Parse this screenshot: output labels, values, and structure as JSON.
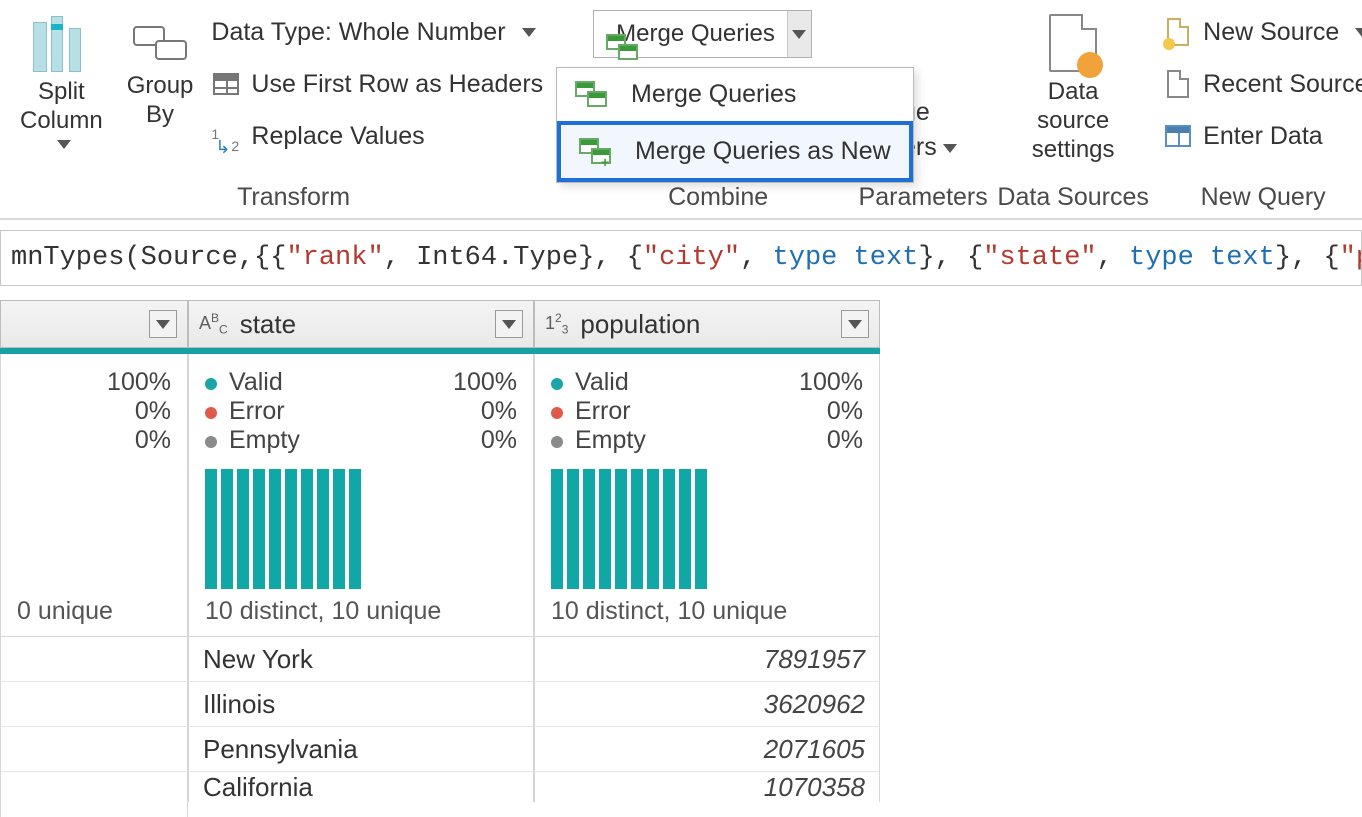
{
  "ribbon": {
    "transform": {
      "split_column": "Split\nColumn",
      "group_by": "Group\nBy",
      "data_type": "Data Type: Whole Number",
      "first_row": "Use First Row as Headers",
      "replace_values": "Replace Values",
      "label": "Transform"
    },
    "combine": {
      "merge_queries": "Merge Queries",
      "menu_merge": "Merge Queries",
      "menu_merge_new": "Merge Queries as New",
      "label": "Combine"
    },
    "parameters": {
      "big": "ge",
      "ers": "ers",
      "label": "Parameters"
    },
    "datasources": {
      "big": "Data source\nsettings",
      "label": "Data Sources"
    },
    "newquery": {
      "new_source": "New Source",
      "recent_sources": "Recent Sources",
      "enter_data": "Enter Data",
      "label": "New Query"
    }
  },
  "formula": {
    "p0": "mnTypes(Source,{{",
    "s1": "\"rank\"",
    "p1": ", Int64.Type}, {",
    "s2": "\"city\"",
    "p2": ", ",
    "kw1": "type text",
    "p3": "}, {",
    "s3": "\"state\"",
    "p4": ", ",
    "kw2": "type text",
    "p5": "}, {",
    "s4": "\"population\"",
    "p6": ","
  },
  "columns": {
    "partial": {
      "distinct": "0 unique",
      "q_valid_pct": "100%",
      "q_error_pct": "0%",
      "q_empty_pct": "0%"
    },
    "state": {
      "name": "state",
      "valid_label": "Valid",
      "valid_pct": "100%",
      "error_label": "Error",
      "error_pct": "0%",
      "empty_label": "Empty",
      "empty_pct": "0%",
      "distinct": "10 distinct, 10 unique",
      "rows": [
        "New York",
        "Illinois",
        "Pennsylvania",
        "California"
      ]
    },
    "population": {
      "name": "population",
      "valid_label": "Valid",
      "valid_pct": "100%",
      "error_label": "Error",
      "error_pct": "0%",
      "empty_label": "Empty",
      "empty_pct": "0%",
      "distinct": "10 distinct, 10 unique",
      "rows": [
        "7891957",
        "3620962",
        "2071605",
        "1070358"
      ]
    }
  }
}
